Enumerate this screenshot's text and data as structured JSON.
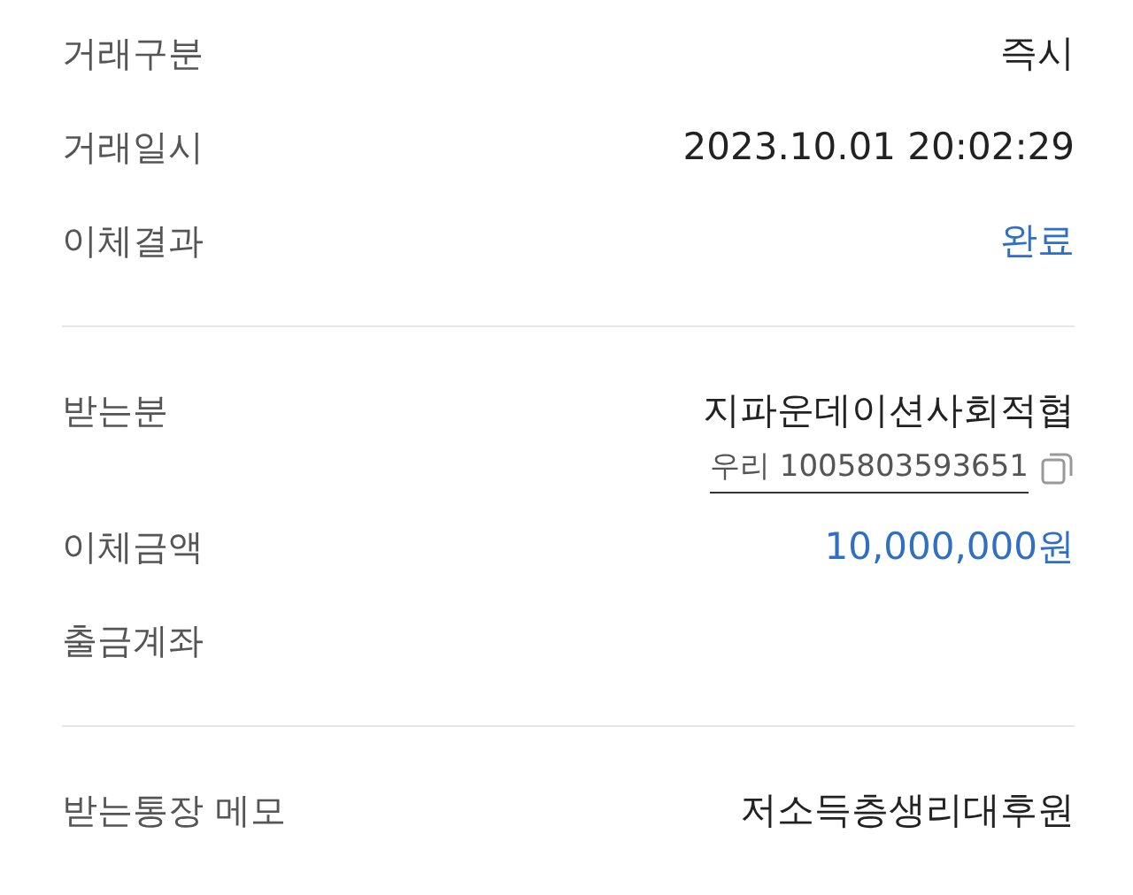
{
  "sections": [
    {
      "rows": [
        {
          "label": "거래구분",
          "value": "즉시",
          "kind": "plain"
        },
        {
          "label": "거래일시",
          "value": "2023.10.01 20:02:29",
          "kind": "plain"
        },
        {
          "label": "이체결과",
          "value": "완료",
          "kind": "accent"
        }
      ]
    },
    {
      "rows": [
        {
          "label": "받는분",
          "value": "지파운데이션사회적협",
          "kind": "plain",
          "account": "우리 1005803593651"
        },
        {
          "label": "이체금액",
          "value": "10,000,000원",
          "kind": "accent"
        },
        {
          "label": "출금계좌"
        }
      ]
    },
    {
      "rows": [
        {
          "label": "받는통장 메모",
          "value": "저소득층생리대후원",
          "kind": "plain"
        }
      ]
    }
  ]
}
